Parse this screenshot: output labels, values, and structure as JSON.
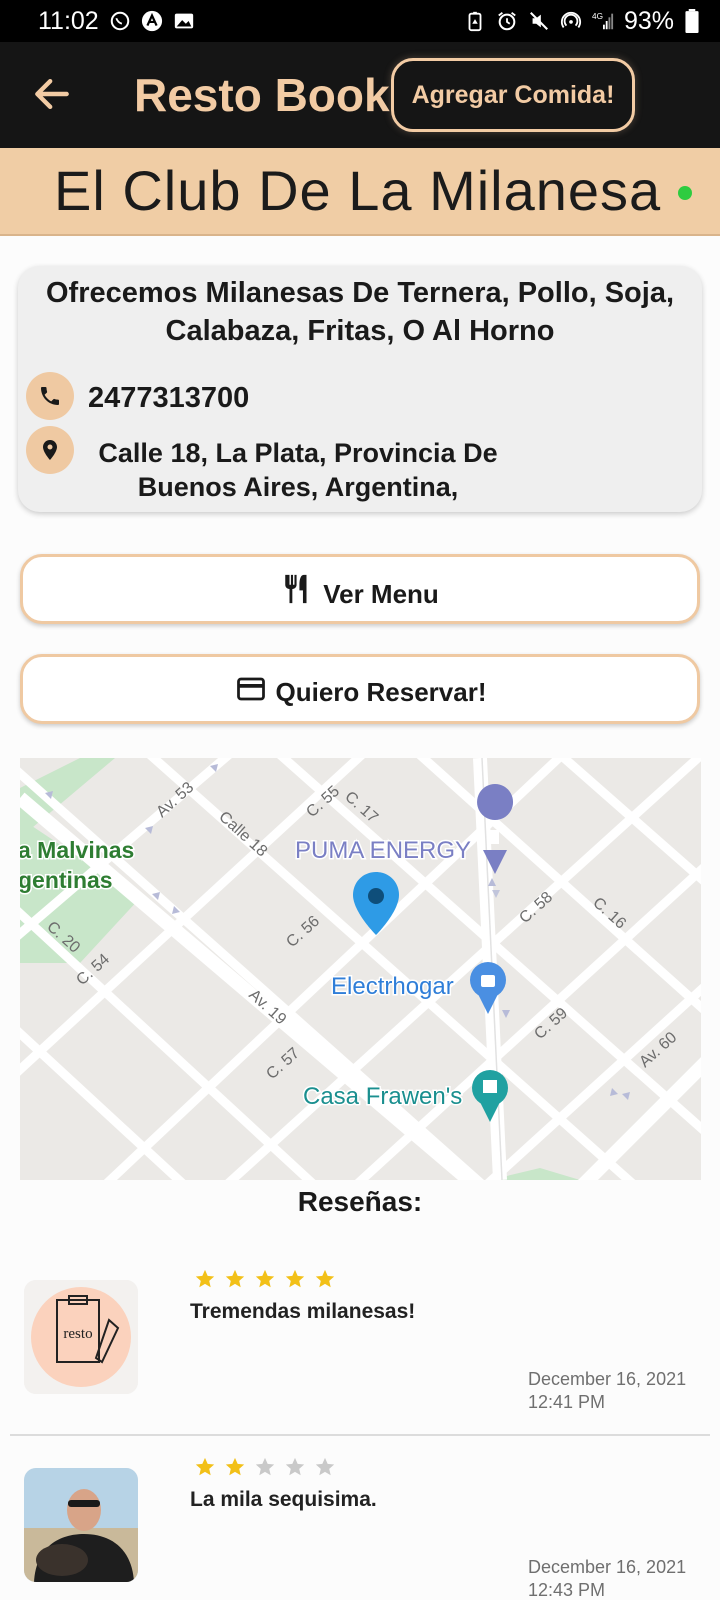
{
  "status_bar": {
    "time": "11:02",
    "battery": "93%",
    "network": "4G"
  },
  "app_bar": {
    "title": "Resto Book",
    "add_food_label": "Agregar Comida!",
    "back_icon": "arrow-left-icon"
  },
  "restaurant": {
    "name": "El Club De La Milanesa",
    "status_color": "#2ecc40",
    "description": "Ofrecemos Milanesas De Ternera, Pollo, Soja, Calabaza, Fritas, O Al Horno",
    "phone": "2477313700",
    "address_line1": "Calle 18, La Plata, Provincia De",
    "address_line2": "Buenos Aires, Argentina,"
  },
  "actions": {
    "menu_label": "Ver Menu",
    "reserve_label": "Quiero Reservar!"
  },
  "map": {
    "labels": {
      "park_1": "a Malvinas",
      "park_2": "gentinas",
      "puma": "PUMA ENERGY",
      "electro": "Electrhogar",
      "casa": "Casa Frawen's",
      "av53": "Av. 53",
      "calle18": "Calle 18",
      "c55": "C. 55",
      "c17": "C. 17",
      "c56": "C. 56",
      "c58": "C. 58",
      "c16": "C. 16",
      "c20": "C. 20",
      "c54": "C. 54",
      "av19": "Av. 19",
      "c57": "C. 57",
      "c59": "C. 59",
      "av60": "Av. 60"
    }
  },
  "reviews": {
    "title": "Reseñas:",
    "items": [
      {
        "rating": 5,
        "text": "Tremendas milanesas!",
        "date": "December 16, 2021",
        "time": "12:41 PM",
        "avatar_text": "resto"
      },
      {
        "rating": 2,
        "text": "La mila sequisima.",
        "date": "December 16, 2021",
        "time": "12:43 PM"
      }
    ]
  },
  "colors": {
    "accent": "#f2cba4",
    "appbar": "#151515",
    "star_on": "#f2c018",
    "star_off": "#c9c9c9"
  }
}
